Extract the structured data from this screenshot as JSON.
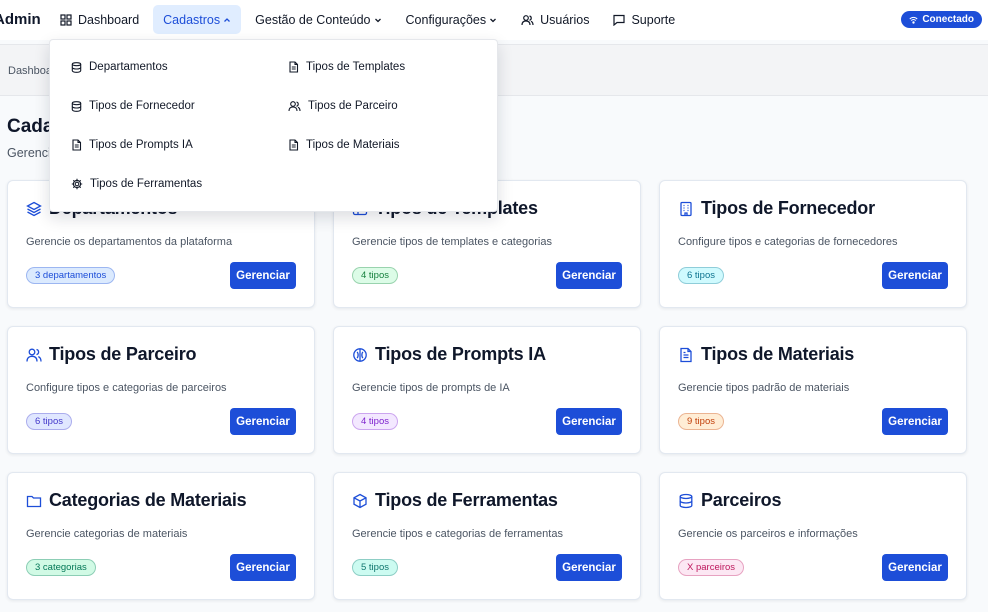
{
  "brand": "Admin",
  "nav": [
    {
      "label": "Dashboard",
      "icon": "dashboard-icon"
    },
    {
      "label": "Cadastros",
      "icon": "",
      "dropdown": true,
      "active": true
    },
    {
      "label": "Gestão de Conteúdo",
      "icon": "",
      "dropdown": true
    },
    {
      "label": "Configurações",
      "icon": "",
      "dropdown": true
    },
    {
      "label": "Usuários",
      "icon": "users-icon"
    },
    {
      "label": "Suporte",
      "icon": "chat-icon"
    }
  ],
  "status": {
    "label": "Conectado",
    "icon": "wifi-icon"
  },
  "breadcrumb": "Dashboard",
  "page": {
    "title": "Cadastros",
    "subtitle": "Gerencie"
  },
  "dropdown": {
    "left": [
      {
        "label": "Departamentos",
        "icon": "database-icon"
      },
      {
        "label": "Tipos de Fornecedor",
        "icon": "database-icon"
      },
      {
        "label": "Tipos de Prompts IA",
        "icon": "document-icon"
      },
      {
        "label": "Tipos de Ferramentas",
        "icon": "gear-icon"
      }
    ],
    "right": [
      {
        "label": "Tipos de Templates",
        "icon": "document-icon"
      },
      {
        "label": "Tipos de Parceiro",
        "icon": "users-icon"
      },
      {
        "label": "Tipos de Materiais",
        "icon": "document-icon"
      }
    ]
  },
  "cards": [
    {
      "title": "Departamentos",
      "desc": "Gerencie os departamentos da plataforma",
      "badge": "3 departamentos",
      "button": "Gerenciar",
      "icon": "layers-icon",
      "badge_color": "#1d4ed8",
      "badge_bg": "#dbeafe"
    },
    {
      "title": "Tipos de Templates",
      "desc": "Gerencie tipos de templates e categorias",
      "badge": "4 tipos",
      "button": "Gerenciar",
      "icon": "template-icon",
      "badge_color": "#15803d",
      "badge_bg": "#dcfce7"
    },
    {
      "title": "Tipos de Fornecedor",
      "desc": "Configure tipos e categorias de fornecedores",
      "badge": "6 tipos",
      "button": "Gerenciar",
      "icon": "building-icon",
      "badge_color": "#0e7490",
      "badge_bg": "#cffafe"
    },
    {
      "title": "Tipos de Parceiro",
      "desc": "Configure tipos e categorias de parceiros",
      "badge": "6 tipos",
      "button": "Gerenciar",
      "icon": "users-icon",
      "badge_color": "#4338ca",
      "badge_bg": "#e0e7ff"
    },
    {
      "title": "Tipos de Prompts IA",
      "desc": "Gerencie tipos de prompts de IA",
      "badge": "4 tipos",
      "button": "Gerenciar",
      "icon": "brain-icon",
      "badge_color": "#7e22ce",
      "badge_bg": "#f3e8ff"
    },
    {
      "title": "Tipos de Materiais",
      "desc": "Gerencie tipos padrão de materiais",
      "badge": "9 tipos",
      "button": "Gerenciar",
      "icon": "document-icon",
      "badge_color": "#c2410c",
      "badge_bg": "#ffedd5"
    },
    {
      "title": "Categorias de Materiais",
      "desc": "Gerencie categorias de materiais",
      "badge": "3 categorias",
      "button": "Gerenciar",
      "icon": "folder-icon",
      "badge_color": "#047857",
      "badge_bg": "#d1fae5"
    },
    {
      "title": "Tipos de Ferramentas",
      "desc": "Gerencie tipos e categorias de ferramentas",
      "badge": "5 tipos",
      "button": "Gerenciar",
      "icon": "cube-icon",
      "badge_color": "#0f766e",
      "badge_bg": "#ccfbf1"
    },
    {
      "title": "Parceiros",
      "desc": "Gerencie os parceiros e informações",
      "badge": "X parceiros",
      "button": "Gerenciar",
      "icon": "database-icon",
      "badge_color": "#be185d",
      "badge_bg": "#fce7f3"
    }
  ]
}
